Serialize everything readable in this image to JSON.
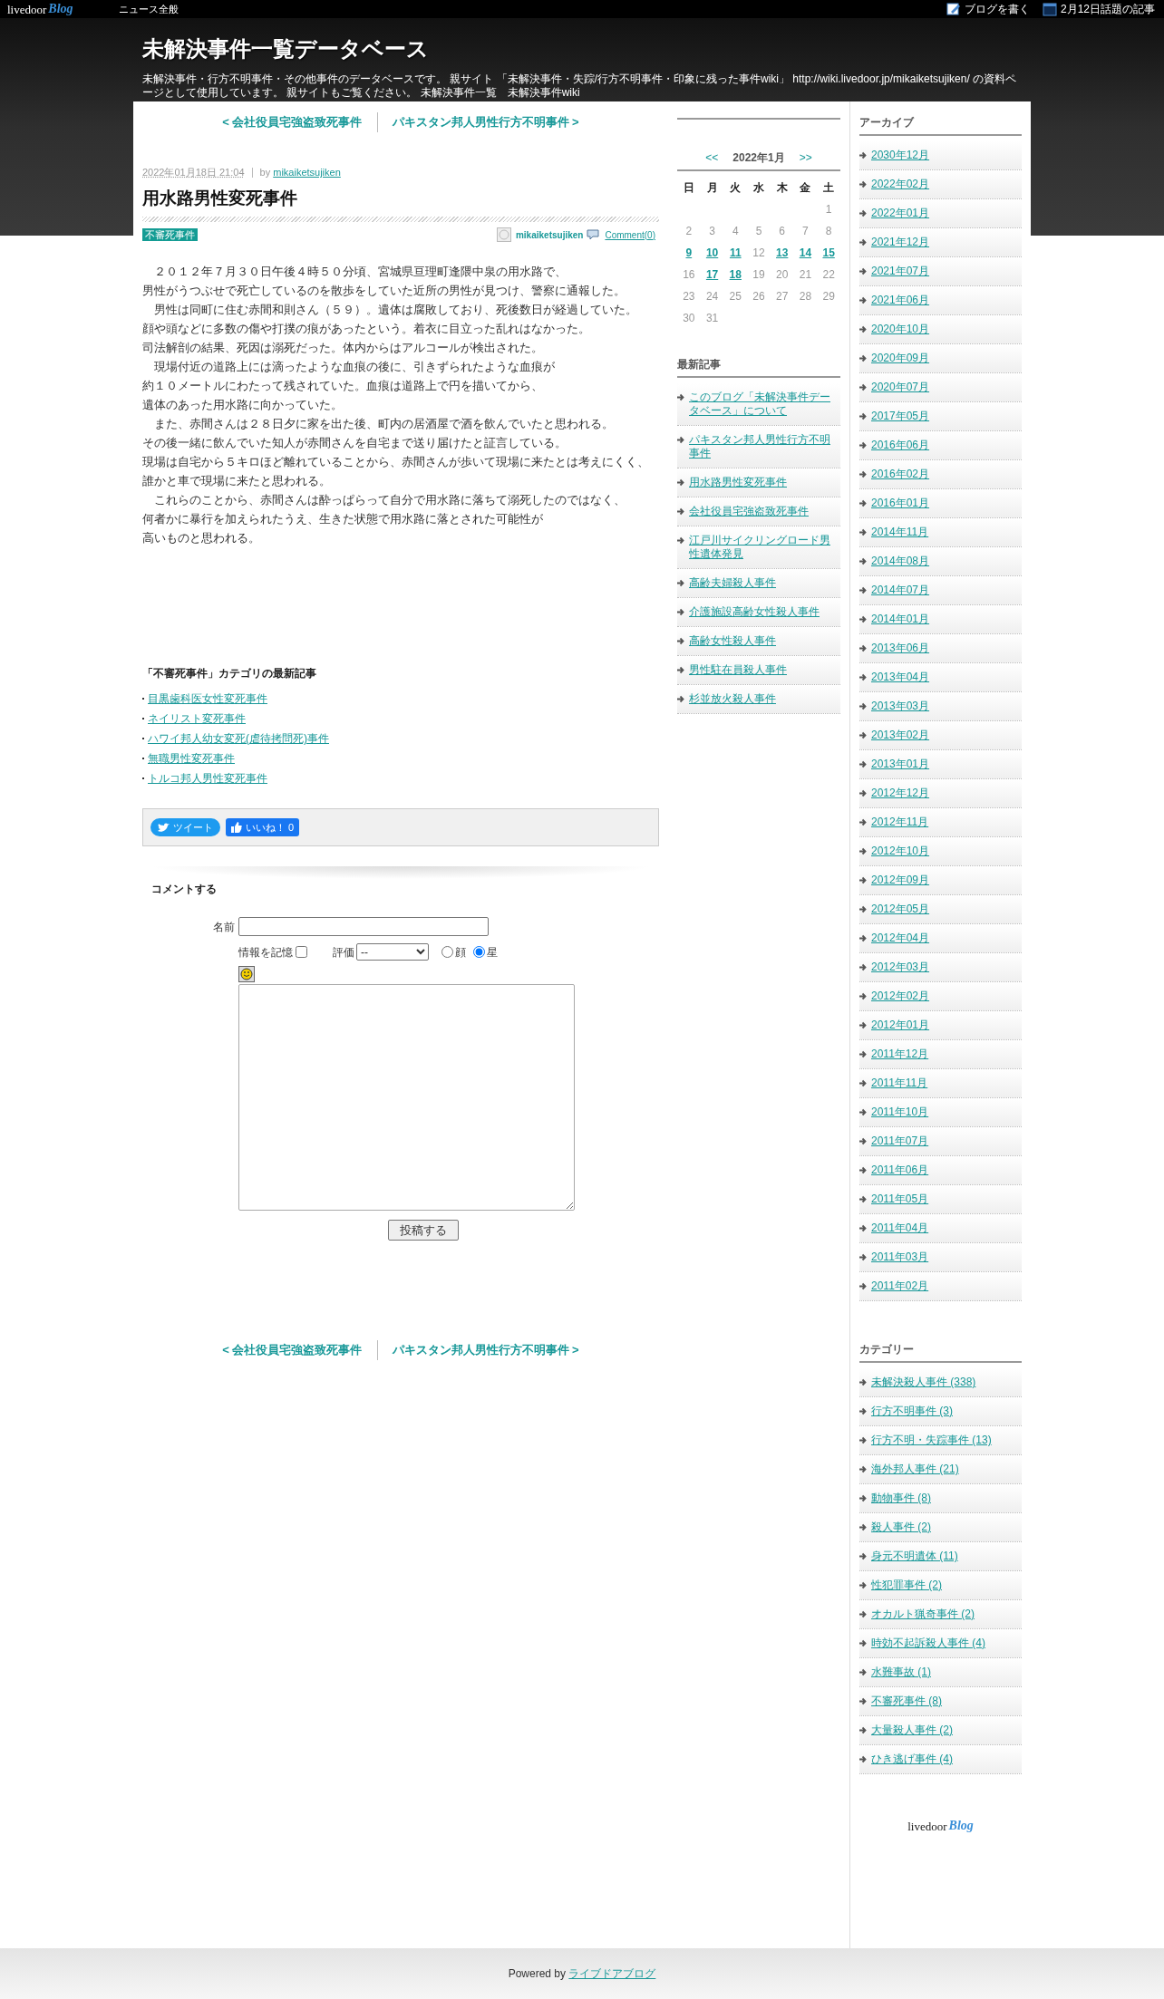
{
  "top_bar": {
    "logo": {
      "word": "livedoor",
      "script": "Blog"
    },
    "news_link": "ニュース全般",
    "write_link": "ブログを書く",
    "topics_link": "2月12日話題の記事"
  },
  "header": {
    "title": "未解決事件一覧データベース",
    "description": "未解決事件・行方不明事件・その他事件のデータベースです。 親サイト 「未解決事件・失踪/行方不明事件・印象に残った事件wiki」 http://wiki.livedoor.jp/mikaiketsujiken/ の資料ページとして使用しています。 親サイトもご覧ください。 未解決事件一覧　未解決事件wiki"
  },
  "article_nav": {
    "previous": "< 会社役員宅強盗致死事件",
    "next": "パキスタン邦人男性行方不明事件 >"
  },
  "article": {
    "date": "2022年01月18日 21:04",
    "by": "by",
    "author": "mikaiketsujiken",
    "title": "用水路男性変死事件",
    "category_tag": "不審死事件",
    "footer_author": "mikaiketsujiken",
    "comment_link": "Comment(0)",
    "body_lines": [
      "　２０１２年７月３０日午後４時５０分頃、宮城県亘理町逢隈中泉の用水路で、",
      "男性がうつぶせで死亡しているのを散歩をしていた近所の男性が見つけ、警察に通報した。",
      "　男性は同町に住む赤間和則さん（５９）。遺体は腐敗しており、死後数日が経過していた。",
      "顔や頭などに多数の傷や打撲の痕があったという。着衣に目立った乱れはなかった。",
      "司法解剖の結果、死因は溺死だった。体内からはアルコールが検出された。",
      "　現場付近の道路上には滴ったような血痕の後に、引きずられたような血痕が",
      "約１０メートルにわたって残されていた。血痕は道路上で円を描いてから、",
      "遺体のあった用水路に向かっていた。",
      "　また、赤間さんは２８日夕に家を出た後、町内の居酒屋で酒を飲んでいたと思われる。",
      "その後一緒に飲んでいた知人が赤間さんを自宅まで送り届けたと証言している。",
      "現場は自宅から５キロほど離れていることから、赤間さんが歩いて現場に来たとは考えにくく、",
      "誰かと車で現場に来たと思われる。",
      "　これらのことから、赤間さんは酔っぱらって自分で用水路に落ちて溺死したのではなく、",
      "何者かに暴行を加えられたうえ、生きた状態で用水路に落とされた可能性が",
      "高いものと思われる。"
    ]
  },
  "related": {
    "heading": "「不審死事件」カテゴリの最新記事",
    "items": [
      "目黒歯科医女性変死事件",
      "ネイリスト変死事件",
      "ハワイ邦人幼女変死(虐待拷問死)事件",
      "無職男性変死事件",
      "トルコ邦人男性変死事件"
    ]
  },
  "share": {
    "tweet": "ツイート",
    "like": "いいね！ 0"
  },
  "comment_form": {
    "heading": "コメントする",
    "name_label": "名前",
    "remember_label": "情報を記憶",
    "remember_checked": false,
    "rating_label": "評価",
    "rating_value": "--",
    "rating_styles": [
      {
        "label": "顔",
        "selected": false
      },
      {
        "label": "星",
        "selected": true
      }
    ],
    "submit": "投稿する"
  },
  "bottom_nav": {
    "previous": "< 会社役員宅強盗致死事件",
    "next": "パキスタン邦人男性行方不明事件 >"
  },
  "calendar": {
    "prev": "<<",
    "month": "2022年1月",
    "next": ">>",
    "weekdays": [
      "日",
      "月",
      "火",
      "水",
      "木",
      "金",
      "土"
    ],
    "weeks": [
      [
        {
          "kind": "empty"
        },
        {
          "kind": "empty"
        },
        {
          "kind": "empty"
        },
        {
          "kind": "empty"
        },
        {
          "kind": "empty"
        },
        {
          "kind": "empty"
        },
        {
          "kind": "day",
          "day": "1",
          "linked": false
        }
      ],
      [
        {
          "kind": "day",
          "day": "2",
          "linked": false
        },
        {
          "kind": "day",
          "day": "3",
          "linked": false
        },
        {
          "kind": "day",
          "day": "4",
          "linked": false
        },
        {
          "kind": "day",
          "day": "5",
          "linked": false
        },
        {
          "kind": "day",
          "day": "6",
          "linked": false
        },
        {
          "kind": "day",
          "day": "7",
          "linked": false
        },
        {
          "kind": "day",
          "day": "8",
          "linked": false
        }
      ],
      [
        {
          "kind": "day",
          "day": "9",
          "linked": true
        },
        {
          "kind": "day",
          "day": "10",
          "linked": true
        },
        {
          "kind": "day",
          "day": "11",
          "linked": true
        },
        {
          "kind": "day",
          "day": "12",
          "linked": false
        },
        {
          "kind": "day",
          "day": "13",
          "linked": true
        },
        {
          "kind": "day",
          "day": "14",
          "linked": true
        },
        {
          "kind": "day",
          "day": "15",
          "linked": true
        }
      ],
      [
        {
          "kind": "day",
          "day": "16",
          "linked": false
        },
        {
          "kind": "day",
          "day": "17",
          "linked": true
        },
        {
          "kind": "day",
          "day": "18",
          "linked": true
        },
        {
          "kind": "day",
          "day": "19",
          "linked": false
        },
        {
          "kind": "day",
          "day": "20",
          "linked": false
        },
        {
          "kind": "day",
          "day": "21",
          "linked": false
        },
        {
          "kind": "day",
          "day": "22",
          "linked": false
        }
      ],
      [
        {
          "kind": "day",
          "day": "23",
          "linked": false
        },
        {
          "kind": "day",
          "day": "24",
          "linked": false
        },
        {
          "kind": "day",
          "day": "25",
          "linked": false
        },
        {
          "kind": "day",
          "day": "26",
          "linked": false
        },
        {
          "kind": "day",
          "day": "27",
          "linked": false
        },
        {
          "kind": "day",
          "day": "28",
          "linked": false
        },
        {
          "kind": "day",
          "day": "29",
          "linked": false
        }
      ],
      [
        {
          "kind": "day",
          "day": "30",
          "linked": false
        },
        {
          "kind": "day",
          "day": "31",
          "linked": false
        }
      ]
    ]
  },
  "recent_posts": {
    "heading": "最新記事",
    "items": [
      "このブログ「未解決事件データベース」について",
      "パキスタン邦人男性行方不明事件",
      "用水路男性変死事件",
      "会社役員宅強盗致死事件",
      "江戸川サイクリングロード男性遺体発見",
      "高齢夫婦殺人事件",
      "介護施設高齢女性殺人事件",
      "高齢女性殺人事件",
      "男性駐在員殺人事件",
      "杉並放火殺人事件"
    ]
  },
  "archive": {
    "heading": "アーカイブ",
    "items": [
      "2030年12月",
      "2022年02月",
      "2022年01月",
      "2021年12月",
      "2021年07月",
      "2021年06月",
      "2020年10月",
      "2020年09月",
      "2020年07月",
      "2017年05月",
      "2016年06月",
      "2016年02月",
      "2016年01月",
      "2014年11月",
      "2014年08月",
      "2014年07月",
      "2014年01月",
      "2013年06月",
      "2013年04月",
      "2013年03月",
      "2013年02月",
      "2013年01月",
      "2012年12月",
      "2012年11月",
      "2012年10月",
      "2012年09月",
      "2012年05月",
      "2012年04月",
      "2012年03月",
      "2012年02月",
      "2012年01月",
      "2011年12月",
      "2011年11月",
      "2011年10月",
      "2011年07月",
      "2011年06月",
      "2011年05月",
      "2011年04月",
      "2011年03月",
      "2011年02月"
    ]
  },
  "categories": {
    "heading": "カテゴリー",
    "items": [
      "未解決殺人事件 (338)",
      "行方不明事件 (3)",
      "行方不明・失踪事件 (13)",
      "海外邦人事件 (21)",
      "動物事件 (8)",
      "殺人事件 (2)",
      "身元不明遺体 (11)",
      "性犯罪事件 (2)",
      "オカルト猟奇事件 (2)",
      "時効不起訴殺人事件 (4)",
      "水難事故 (1)",
      "不審死事件 (8)",
      "大量殺人事件 (2)",
      "ひき逃げ事件 (4)"
    ]
  },
  "sidebar_logo": {
    "word": "livedoor",
    "script": "Blog"
  },
  "footer": {
    "text": "Powered by",
    "link": "ライブドアブログ"
  }
}
